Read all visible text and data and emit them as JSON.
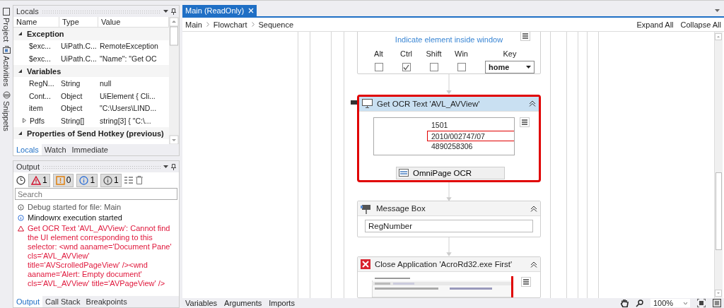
{
  "sidebar_tabs": [
    {
      "label": "Project",
      "selected": false
    },
    {
      "label": "Activities",
      "selected": false
    },
    {
      "label": "Snippets",
      "selected": false
    }
  ],
  "locals": {
    "title": "Locals",
    "columns": [
      "Name",
      "Type",
      "Value"
    ],
    "groups": [
      {
        "name": "Exception",
        "expanded": true,
        "children": [
          {
            "name": "$exc...",
            "type": "UiPath.C...",
            "value": "RemoteException",
            "kind": "plain"
          },
          {
            "name": "$exc...",
            "type": "UiPath.C...",
            "value": "\"Name\": \"Get OC",
            "kind": "plain"
          }
        ]
      },
      {
        "name": "Variables",
        "expanded": true,
        "children": [
          {
            "name": "RegN...",
            "type": "String",
            "value": "null",
            "kind": "plain"
          },
          {
            "name": "Cont...",
            "type": "Object",
            "value": "UiElement { Cli...",
            "kind": "plain"
          },
          {
            "name": "item",
            "type": "Object",
            "value": "\"C:\\Users\\LIND...",
            "kind": "plain"
          },
          {
            "name": "Pdfs",
            "type": "String[]",
            "value": "string[3] { \"C:\\...",
            "kind": "expandable"
          }
        ]
      },
      {
        "name": "Properties of Send Hotkey (previous)",
        "expanded": true
      }
    ],
    "tabs": [
      {
        "label": "Locals",
        "selected": true
      },
      {
        "label": "Watch",
        "selected": false
      },
      {
        "label": "Immediate",
        "selected": false
      }
    ]
  },
  "output": {
    "title": "Output",
    "filters": [
      {
        "kind": "error",
        "count": "1",
        "selected": true
      },
      {
        "kind": "warning",
        "count": "0",
        "selected": true
      },
      {
        "kind": "info",
        "count": "1",
        "selected": true
      },
      {
        "kind": "trace",
        "count": "1",
        "selected": true
      }
    ],
    "search": {
      "placeholder": "Search"
    },
    "messages": [
      {
        "kind": "trace",
        "text": "Debug started for file: Main"
      },
      {
        "kind": "info",
        "text": "Mindowrx execution started"
      },
      {
        "kind": "error",
        "text": "Get OCR Text 'AVL_AVView': Cannot find the UI element corresponding to this selector: <wnd aaname='Document Pane' cls='AVL_AVView' title='AVScrolledPageView' /><wnd aaname='Alert: Empty document' cls='AVL_AVView' title='AVPageView' />"
      }
    ],
    "tabs": [
      {
        "label": "Output",
        "selected": true
      },
      {
        "label": "Call Stack",
        "selected": false
      },
      {
        "label": "Breakpoints",
        "selected": false
      }
    ]
  },
  "document_tabs": [
    {
      "label": "Main (ReadOnly)",
      "selected": true
    }
  ],
  "breadcrumb": [
    "Main",
    "Flowchart",
    "Sequence"
  ],
  "toolbar_links": [
    "Expand All",
    "Collapse All"
  ],
  "activities": [
    {
      "kind": "hotkey",
      "selected": false,
      "link": "Indicate element inside window",
      "modifiers": [
        {
          "label": "Alt",
          "checked": false
        },
        {
          "label": "Ctrl",
          "checked": true
        },
        {
          "label": "Shift",
          "checked": false
        },
        {
          "label": "Win",
          "checked": false
        }
      ],
      "key_label": "Key",
      "key": "home"
    },
    {
      "kind": "ocr",
      "selected": true,
      "title": "Get OCR Text 'AVL_AVView'",
      "snapshot_lines": [
        {
          "text": "1501",
          "highlighted": false
        },
        {
          "text": "2010/002747/07",
          "highlighted": true
        },
        {
          "text": "4890258306",
          "highlighted": false
        }
      ],
      "engine": "OmniPage OCR"
    },
    {
      "kind": "message",
      "selected": false,
      "title": "Message Box",
      "value": "RegNumber"
    },
    {
      "kind": "close",
      "selected": false,
      "title": "Close Application 'AcroRd32.exe First'"
    }
  ],
  "bottom_tabs": [
    "Variables",
    "Arguments",
    "Imports"
  ],
  "zoom": "100%"
}
